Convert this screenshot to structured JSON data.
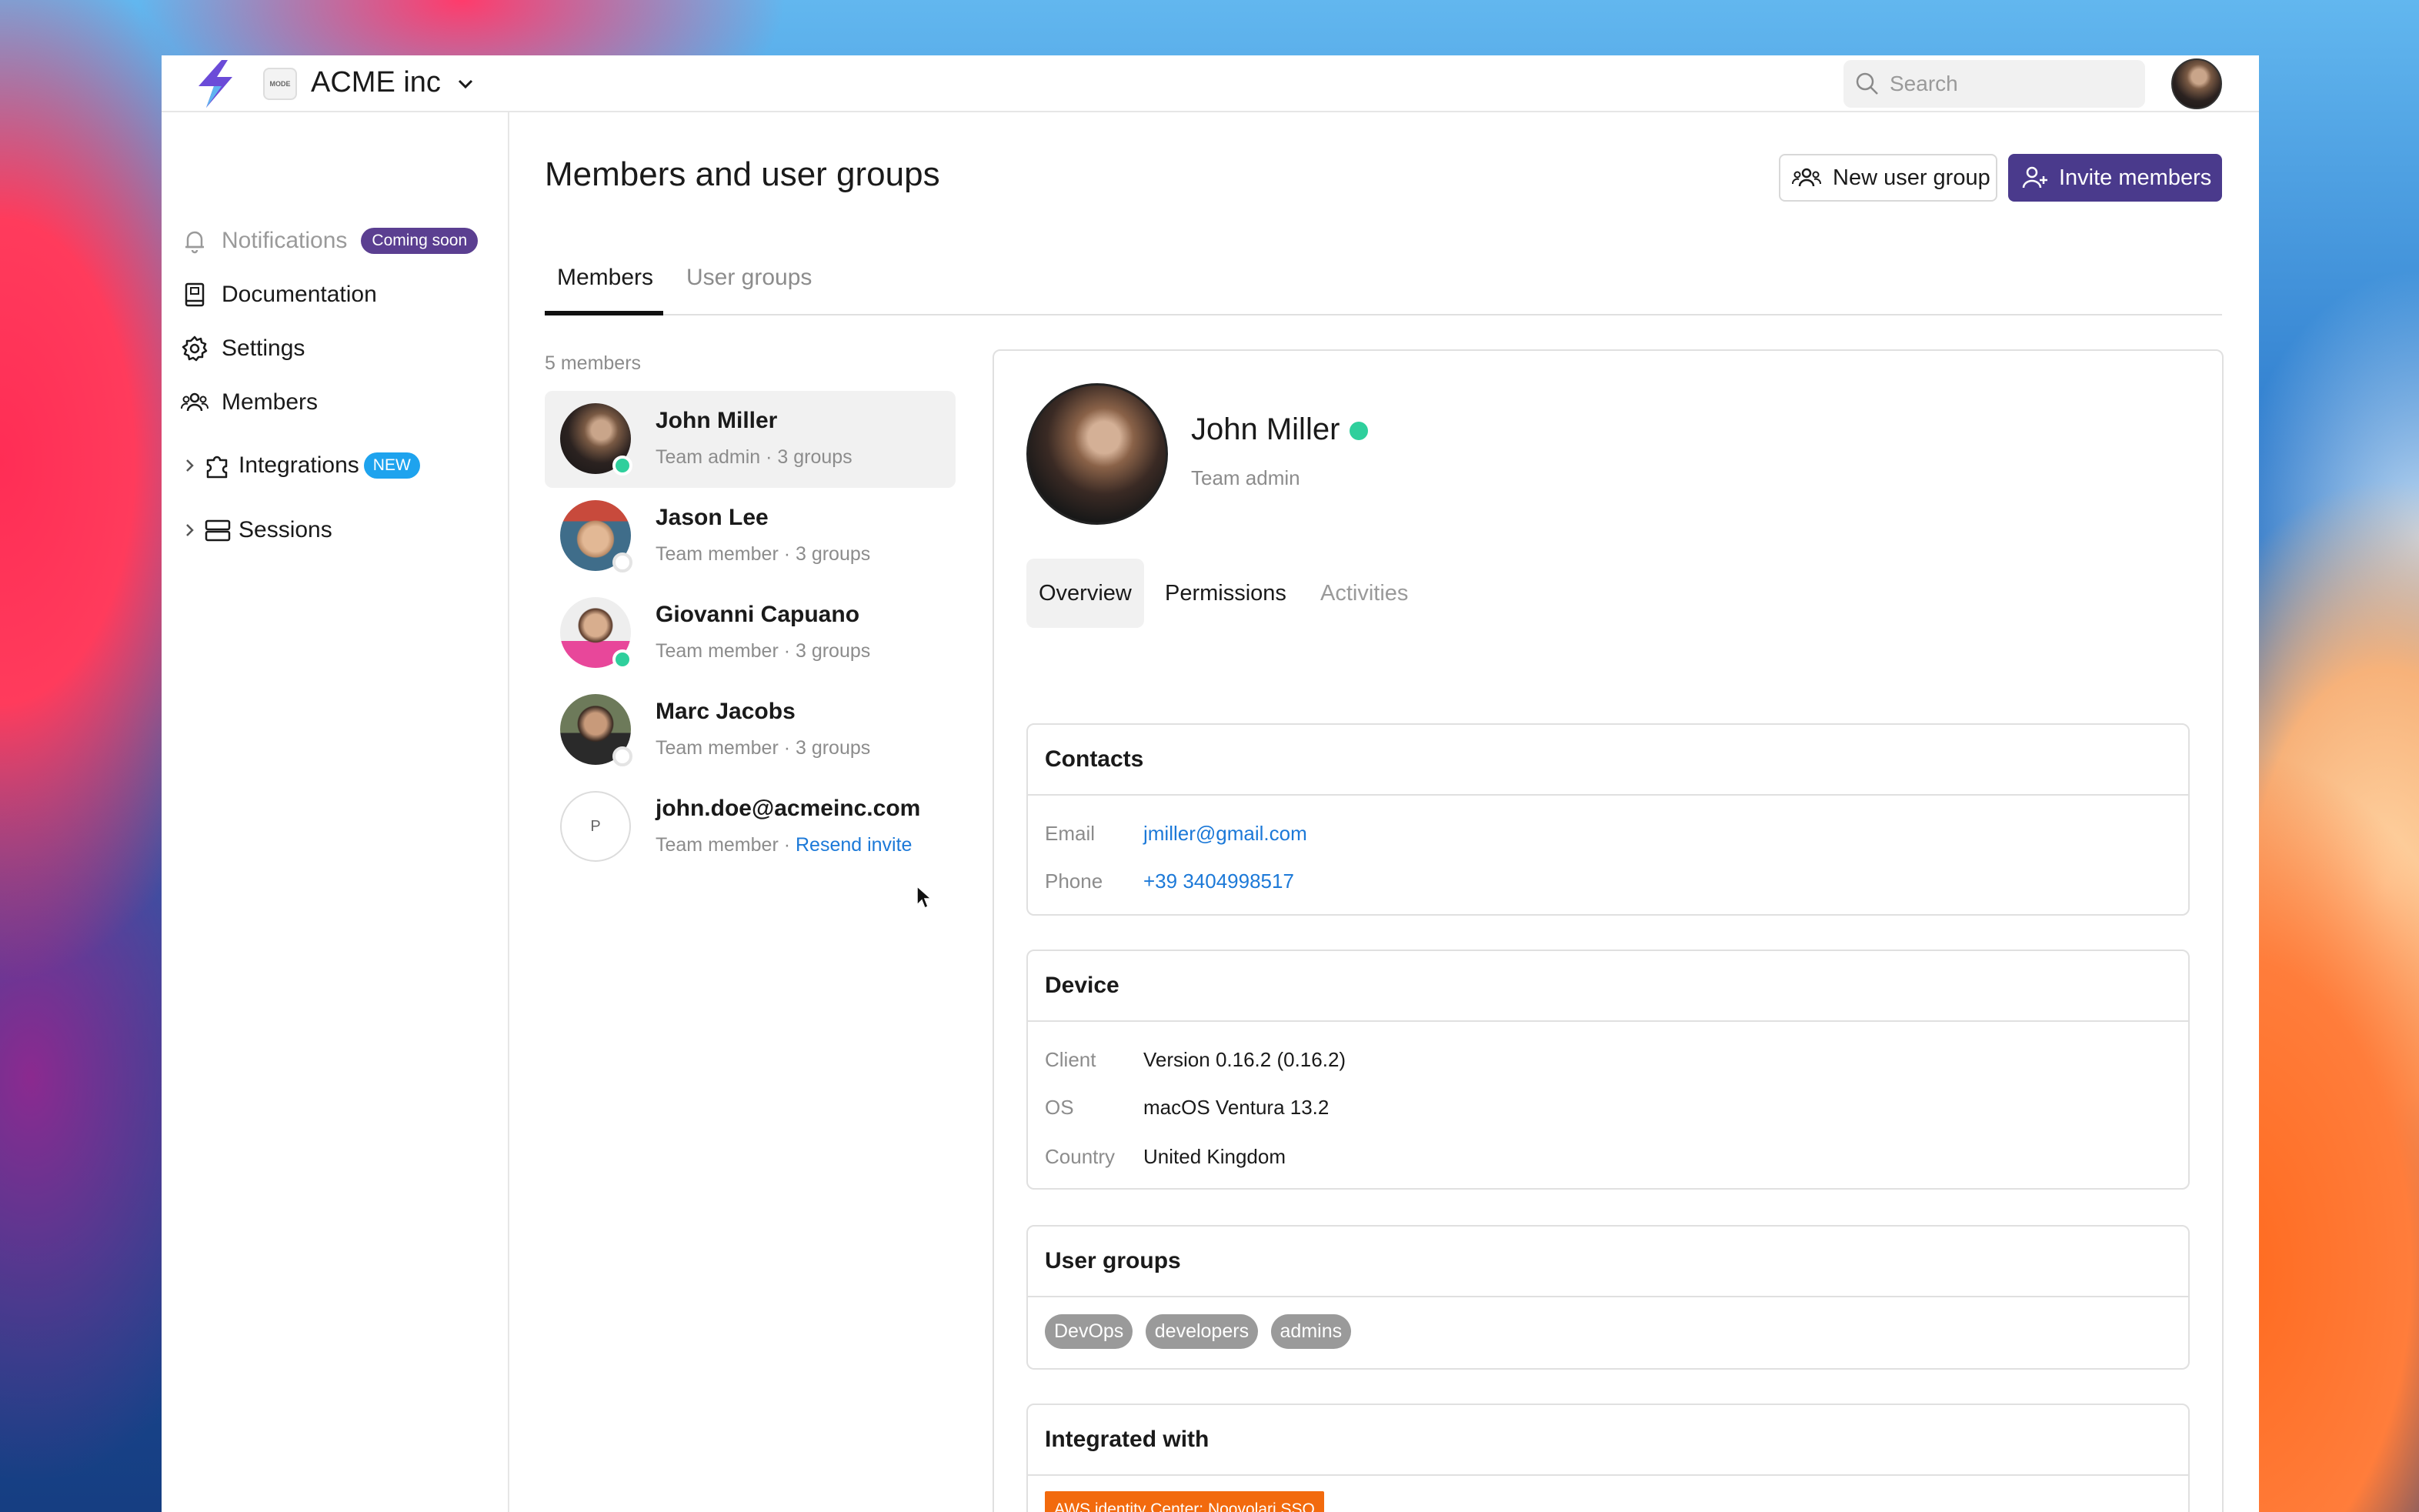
{
  "header": {
    "org_icon_text": "MODE",
    "org_name": "ACME inc",
    "search_placeholder": "Search"
  },
  "sidebar": {
    "items": [
      {
        "label": "Notifications",
        "icon": "bell-icon",
        "badge": "Coming soon"
      },
      {
        "label": "Documentation",
        "icon": "book-icon"
      },
      {
        "label": "Settings",
        "icon": "gear-icon"
      },
      {
        "label": "Members",
        "icon": "users-icon"
      },
      {
        "label": "Integrations",
        "icon": "puzzle-icon",
        "badge": "NEW"
      },
      {
        "label": "Sessions",
        "icon": "server-icon"
      }
    ]
  },
  "main": {
    "title": "Members and user groups",
    "new_group_label": "New user group",
    "invite_label": "Invite members",
    "tabs": [
      "Members",
      "User groups"
    ],
    "member_count": "5 members",
    "members": [
      {
        "name": "John Miller",
        "sub": "Team admin · 3 groups",
        "status": "online"
      },
      {
        "name": "Jason Lee",
        "sub": "Team member · 3 groups",
        "status": "offline"
      },
      {
        "name": "Giovanni Capuano",
        "sub": "Team member · 3 groups",
        "status": "online"
      },
      {
        "name": "Marc Jacobs",
        "sub": "Team member · 3 groups",
        "status": "offline"
      },
      {
        "name": "john.doe@acmeinc.com",
        "sub": "Team member · ",
        "link": "Resend invite",
        "initial": "P"
      }
    ]
  },
  "detail": {
    "name": "John Miller",
    "role": "Team admin",
    "tabs": [
      "Overview",
      "Permissions",
      "Activities"
    ],
    "contacts": {
      "title": "Contacts",
      "email_label": "Email",
      "email": "jmiller@gmail.com",
      "phone_label": "Phone",
      "phone": "+39 3404998517"
    },
    "device": {
      "title": "Device",
      "client_label": "Client",
      "client": "Version 0.16.2 (0.16.2)",
      "os_label": "OS",
      "os": "macOS Ventura 13.2",
      "country_label": "Country",
      "country": "United Kingdom"
    },
    "groups": {
      "title": "User groups",
      "tags": [
        "DevOps",
        "developers",
        "admins"
      ]
    },
    "integrated": {
      "title": "Integrated with",
      "item": "AWS identity Center: Noovolari SSO"
    }
  },
  "colors": {
    "accent": "#4a3a8c",
    "online": "#2fcf9c",
    "link": "#1c79d8",
    "new_badge": "#1ea3ee",
    "integration": "#f26a0d"
  }
}
